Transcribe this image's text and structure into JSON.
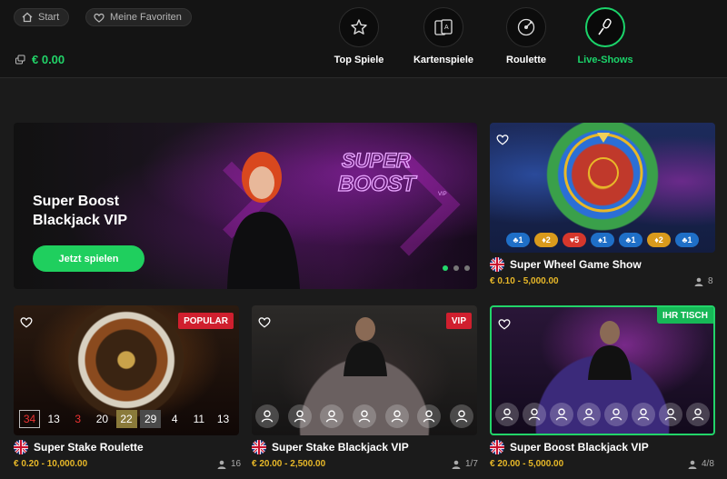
{
  "header": {
    "start_label": "Start",
    "favorites_label": "Meine Favoriten",
    "balance": "€ 0.00",
    "categories": [
      {
        "label": "Top Spiele",
        "icon": "star-icon"
      },
      {
        "label": "Kartenspiele",
        "icon": "cards-icon"
      },
      {
        "label": "Roulette",
        "icon": "roulette-icon"
      },
      {
        "label": "Live-Shows",
        "icon": "microphone-icon",
        "active": true
      }
    ]
  },
  "hero": {
    "title": "Super Boost Blackjack VIP",
    "cta_label": "Jetzt spielen"
  },
  "games": {
    "wheel": {
      "title": "Super Wheel Game Show",
      "price": "€ 0.10 - 5,000.00",
      "players": "8",
      "chips": [
        {
          "suit": "♣",
          "value": "1",
          "color": "#1f6fc7"
        },
        {
          "suit": "♦",
          "value": "2",
          "color": "#d99a1c"
        },
        {
          "suit": "♥",
          "value": "5",
          "color": "#d5372c"
        },
        {
          "suit": "♠",
          "value": "1",
          "color": "#1f6fc7"
        },
        {
          "suit": "♣",
          "value": "1",
          "color": "#1f6fc7"
        },
        {
          "suit": "♦",
          "value": "2",
          "color": "#d99a1c"
        },
        {
          "suit": "♣",
          "value": "1",
          "color": "#1f6fc7"
        }
      ]
    },
    "roulette": {
      "badge": "POPULAR",
      "title": "Super Stake Roulette",
      "price": "€ 0.20 - 10,000.00",
      "players": "16",
      "numbers": [
        "34",
        "13",
        "3",
        "20",
        "22",
        "29",
        "4",
        "11",
        "13"
      ]
    },
    "bj": {
      "badge": "VIP",
      "title": "Super Stake Blackjack VIP",
      "price": "€ 20.00 - 2,500.00",
      "players": "1/7"
    },
    "sb": {
      "badge": "IHR TISCH",
      "title": "Super Boost Blackjack VIP",
      "price": "€ 20.00 - 5,000.00",
      "players": "4/8"
    }
  },
  "colors": {
    "accent_green": "#1fcf5e",
    "price_gold": "#e8b828",
    "badge_red": "#d01f2e"
  }
}
